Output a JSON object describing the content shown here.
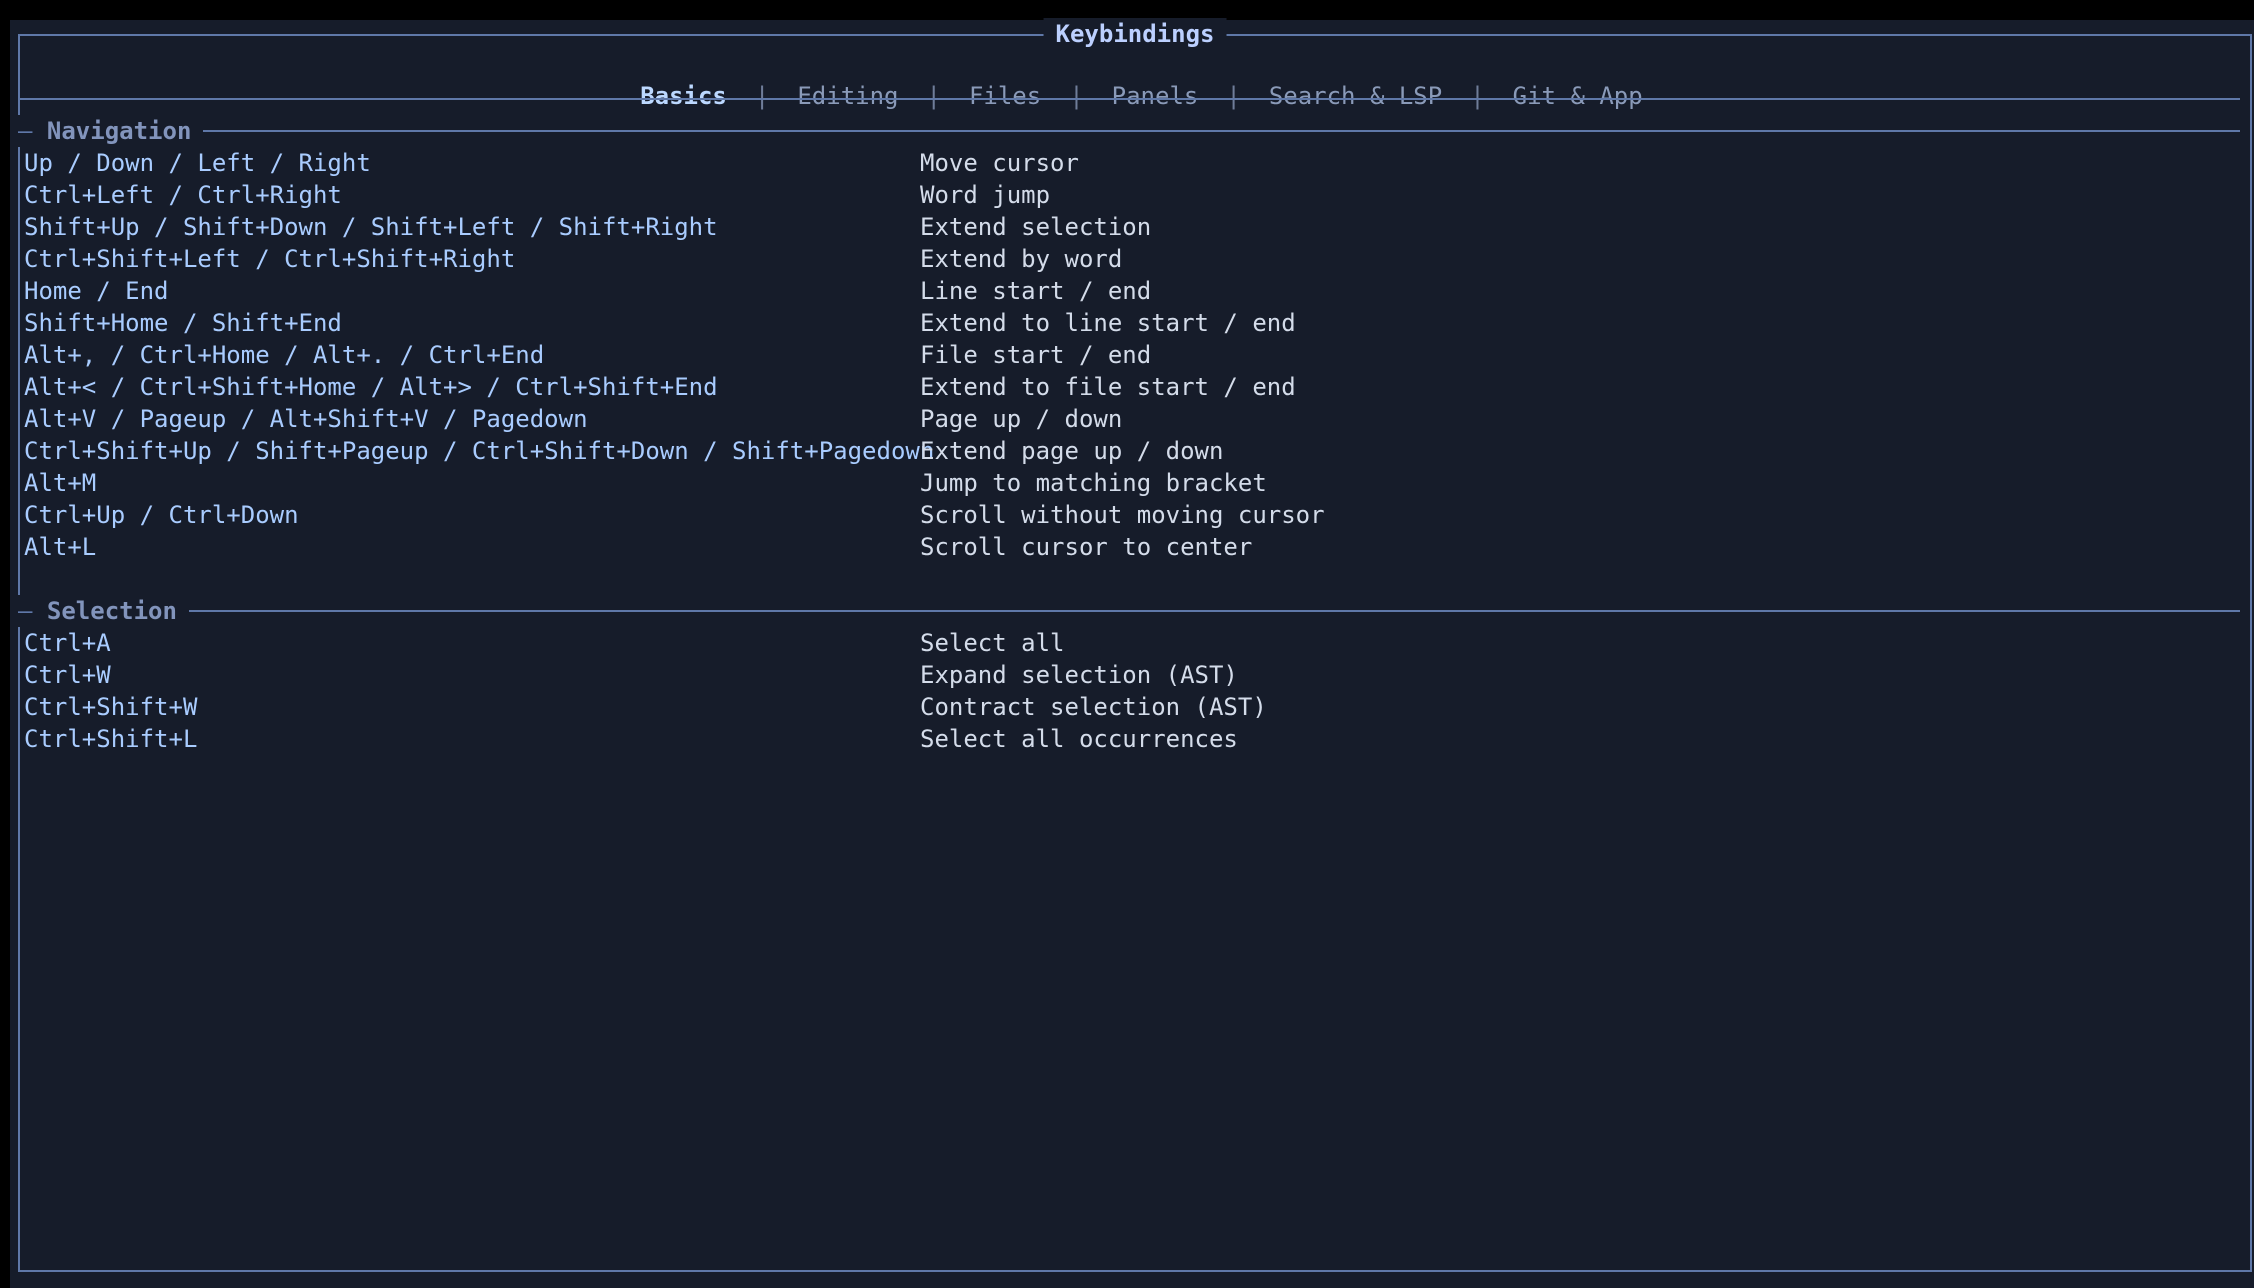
{
  "window": {
    "title": "Keybindings"
  },
  "tabs": [
    {
      "label": "Basics",
      "active": true
    },
    {
      "label": "Editing",
      "active": false
    },
    {
      "label": "Files",
      "active": false
    },
    {
      "label": "Panels",
      "active": false
    },
    {
      "label": "Search & LSP",
      "active": false
    },
    {
      "label": "Git & App",
      "active": false
    }
  ],
  "tab_separator": "|",
  "sections": {
    "navigation": {
      "marker": "—",
      "title": "Navigation",
      "rows": [
        {
          "keys": "Up / Down / Left / Right",
          "action": "Move cursor"
        },
        {
          "keys": "Ctrl+Left / Ctrl+Right",
          "action": "Word jump"
        },
        {
          "keys": "Shift+Up / Shift+Down / Shift+Left / Shift+Right",
          "action": "Extend selection"
        },
        {
          "keys": "Ctrl+Shift+Left / Ctrl+Shift+Right",
          "action": "Extend by word"
        },
        {
          "keys": "Home / End",
          "action": "Line start / end"
        },
        {
          "keys": "Shift+Home / Shift+End",
          "action": "Extend to line start / end"
        },
        {
          "keys": "Alt+, / Ctrl+Home / Alt+. / Ctrl+End",
          "action": "File start / end"
        },
        {
          "keys": "Alt+< / Ctrl+Shift+Home / Alt+> / Ctrl+Shift+End",
          "action": "Extend to file start / end"
        },
        {
          "keys": "Alt+V / Pageup / Alt+Shift+V / Pagedown",
          "action": "Page up / down"
        },
        {
          "keys": "Ctrl+Shift+Up / Shift+Pageup / Ctrl+Shift+Down / Shift+Pagedown",
          "action": "Extend page up / down"
        },
        {
          "keys": "Alt+M",
          "action": "Jump to matching bracket"
        },
        {
          "keys": "Ctrl+Up / Ctrl+Down",
          "action": "Scroll without moving cursor"
        },
        {
          "keys": "Alt+L",
          "action": "Scroll cursor to center"
        }
      ]
    },
    "selection": {
      "marker": "—",
      "title": "Selection",
      "rows": [
        {
          "keys": "Ctrl+A",
          "action": "Select all"
        },
        {
          "keys": "Ctrl+W",
          "action": "Expand selection (AST)"
        },
        {
          "keys": "Ctrl+Shift+W",
          "action": "Contract selection (AST)"
        },
        {
          "keys": "Ctrl+Shift+L",
          "action": "Select all occurrences"
        }
      ]
    }
  },
  "colors": {
    "background": "#161c2a",
    "border": "#5f78a8",
    "key_text": "#a9ccff",
    "description_text": "#d4dcea",
    "active_tab": "#bcd8ff",
    "inactive_tab": "#8a9ab8"
  }
}
